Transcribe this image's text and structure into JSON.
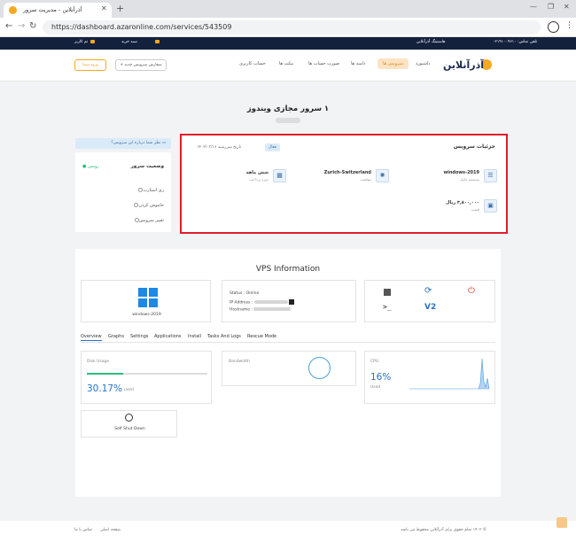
{
  "browser": {
    "tab_title": "آذرآنلاین - مدیریت سرور",
    "url": "https://dashboard.azaronline.com/services/543509"
  },
  "topbar": {
    "phone": "تلفن تماس: ۰۲۱۹۱۰۰۹۶۱۰",
    "hosting": "هاستینگ آذرآنلاین",
    "cart": "سبد خرید",
    "lang": "تم کاربر"
  },
  "header": {
    "nav": [
      "داشبورد",
      "سرویس ها",
      "دامنه ها",
      "صورت حساب ها",
      "تیکت ها",
      "حساب کاربری"
    ],
    "add_service": "+ سفارش سرویس جدید",
    "login": "ورود شما"
  },
  "page": {
    "title": "۱ سرور مجازی ویندوز"
  },
  "side": {
    "help": "نظر شما درباره این سرویس؟",
    "status_title": "وضعیت سرور",
    "status_value": "روشن",
    "actions": [
      "ری استارت",
      "خاموش کردن",
      "تغییر سرویس"
    ]
  },
  "details": {
    "title": "جزئیات سرویس",
    "badge": "فعال",
    "date": "تاریخ سررسید ۱۴۰۲/۰۳/۱۶",
    "os_value": "windows-2019",
    "os_label": "سیستم عامل",
    "location_value": "Zurich-Switzerland",
    "location_label": "موقعیت",
    "cycle_value": "شش ماهه",
    "cycle_label": "دوره پرداخت",
    "price_value": "۳,۸۰۰,۰۰۰ ریال",
    "price_label": "قیمت"
  },
  "vps": {
    "title": "VPS Information",
    "os_caption": "windows-2019",
    "status_line": "Status : Online",
    "ip_label": "IP Address :",
    "hostname_label": "Hostname :",
    "tabs": [
      "Overview",
      "Graphs",
      "Settings",
      "Applications",
      "Install",
      "Tasks And Logs",
      "Rescue Mode"
    ],
    "disk_label": "Disk Usage",
    "disk_pct": "30.17%",
    "disk_used": "used",
    "disk_fill": 0.3017,
    "bandwidth_label": "Bandwidth",
    "cpu_label": "CPU",
    "cpu_pct": "16%",
    "cpu_used": "Used",
    "shutdown_label": "Self Shut Down"
  },
  "footer": {
    "copyright": "© ۱۴۰۲ تمام حقوق برای آذرآنلاین محفوظ می باشد",
    "home": "صفحه اصلی",
    "contact": "تماس با ما"
  },
  "colors": {
    "accent": "#f6a821",
    "highlight": "#e11d2a",
    "blue": "#2a72c7",
    "green": "#2dbd7e"
  }
}
